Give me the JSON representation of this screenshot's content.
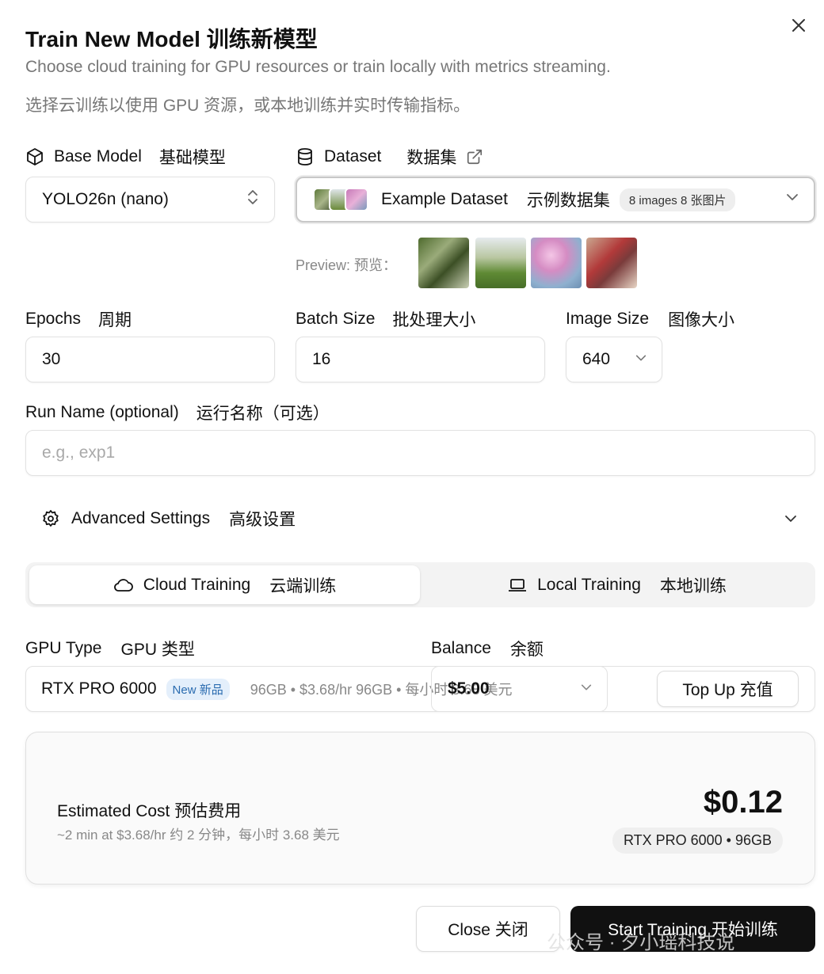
{
  "header": {
    "title": "Train New Model  训练新模型",
    "subtitle_en": "Choose cloud training for GPU resources or train locally with metrics streaming.",
    "subtitle_zh": "选择云训练以使用 GPU 资源，或本地训练并实时传输指标。"
  },
  "base_model": {
    "label_en": "Base Model",
    "label_zh": "基础模型",
    "value": "YOLO26n (nano)"
  },
  "dataset": {
    "label_en": "Dataset",
    "label_zh": "数据集",
    "value_en": "Example Dataset",
    "value_zh": "示例数据集",
    "count_badge": "8 images   8 张图片",
    "preview_label": "Preview:  预览："
  },
  "epochs": {
    "label_en": "Epochs",
    "label_zh": "周期",
    "value": "30"
  },
  "batch_size": {
    "label_en": "Batch Size",
    "label_zh": "批处理大小",
    "value": "16"
  },
  "image_size": {
    "label_en": "Image Size",
    "label_zh": "图像大小",
    "value": "640"
  },
  "run_name": {
    "label_en": "Run Name (optional)",
    "label_zh": "运行名称（可选）",
    "placeholder": "e.g., exp1"
  },
  "advanced": {
    "label_en": "Advanced Settings",
    "label_zh": "高级设置"
  },
  "tabs": {
    "cloud_en": "Cloud Training",
    "cloud_zh": "云端训练",
    "local_en": "Local Training",
    "local_zh": "本地训练",
    "active": "cloud"
  },
  "gpu": {
    "label_en": "GPU Type",
    "label_zh": "GPU 类型",
    "value": "RTX PRO 6000",
    "new_badge": "New   新品",
    "detail": "96GB • $3.68/hr  96GB • 每小时 3.68 美元"
  },
  "balance": {
    "label_en": "Balance",
    "label_zh": "余额",
    "value": "$5.00",
    "top_up_label": "Top Up    充值"
  },
  "estimate": {
    "label": "Estimated Cost  预估费用",
    "detail": "~2 min at $3.68/hr  约 2 分钟，每小时 3.68 美元",
    "amount": "$0.12",
    "gpu_badge": "RTX PRO 6000 • 96GB"
  },
  "footer": {
    "close_label": "Close    关闭",
    "start_label": "Start Training    开始训练",
    "watermark": "公众号 · 夕小瑶科技说"
  },
  "colors": {
    "primary_button": "#111111",
    "new_badge_bg": "#e4effb",
    "new_badge_text": "#2b6cb0",
    "muted_text": "#777777"
  },
  "icons": [
    "close-icon",
    "cube-icon",
    "database-icon",
    "external-link-icon",
    "chevron-up-down-icon",
    "chevron-down-icon",
    "gear-icon",
    "cloud-icon",
    "laptop-icon"
  ]
}
